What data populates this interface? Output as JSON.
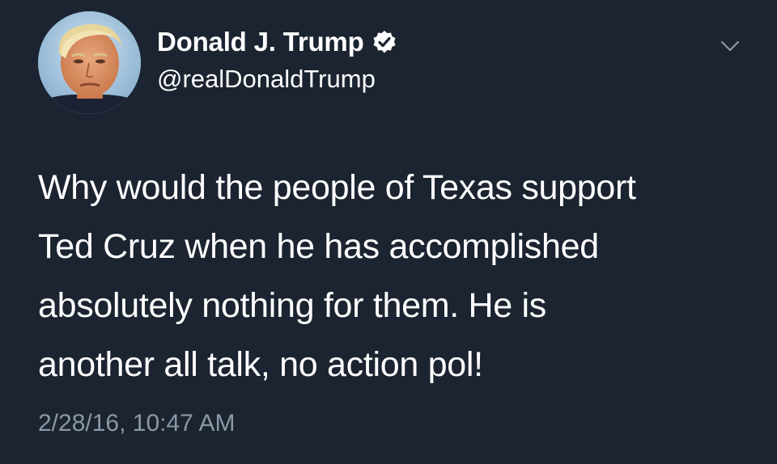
{
  "author": {
    "display_name": "Donald J. Trump",
    "handle": "@realDonaldTrump",
    "verified_icon": "verified-badge-icon",
    "avatar_icon": "profile-photo"
  },
  "menu": {
    "icon": "chevron-down-icon"
  },
  "tweet": {
    "text": "Why would the people of Texas support\nTed Cruz when he has accomplished\nabsolutely nothing for them. He is\nanother all talk, no action pol!",
    "timestamp": "2/28/16, 10:47 AM"
  },
  "colors": {
    "background": "#1b2430",
    "text": "#ffffff",
    "timestamp": "#8b98a5",
    "caret": "#8b98a5"
  }
}
